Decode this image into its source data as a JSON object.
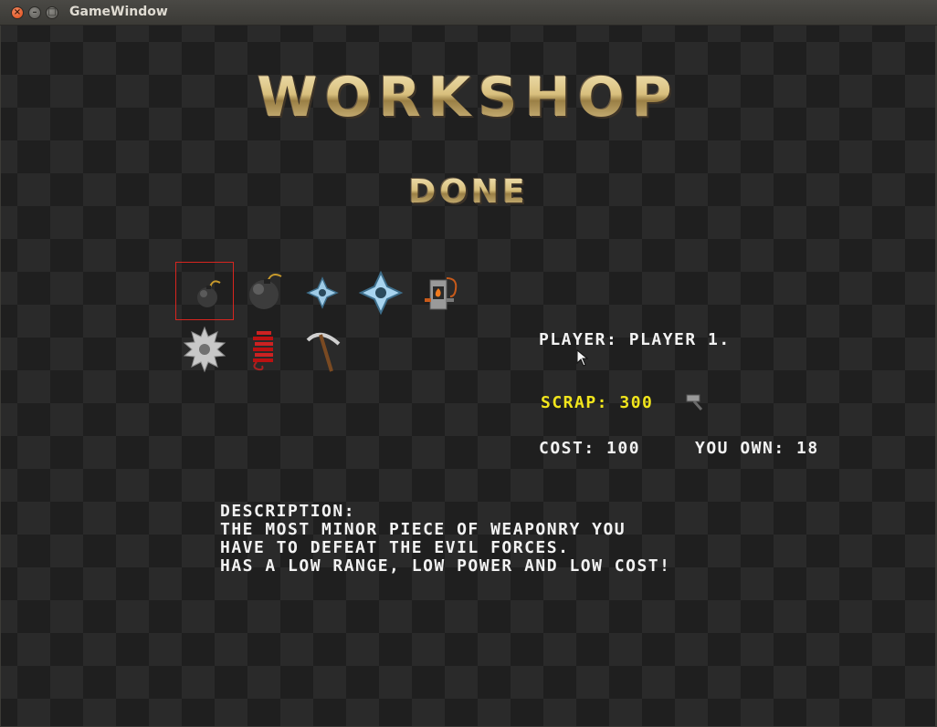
{
  "window": {
    "title": "GameWindow",
    "close_glyph": "×",
    "minimize_glyph": "–",
    "maximize_glyph": "□"
  },
  "screen": {
    "title": "WORKSHOP",
    "done_label": "DONE"
  },
  "items": [
    {
      "name": "small-bomb",
      "icon": "small-bomb-icon",
      "selected": true
    },
    {
      "name": "large-bomb",
      "icon": "large-bomb-icon",
      "selected": false
    },
    {
      "name": "small-shuriken",
      "icon": "small-shuriken-icon",
      "selected": false
    },
    {
      "name": "large-shuriken",
      "icon": "large-shuriken-icon",
      "selected": false
    },
    {
      "name": "fire-trap",
      "icon": "fire-trap-icon",
      "selected": false
    },
    {
      "name": "saw-blade",
      "icon": "saw-blade-icon",
      "selected": false
    },
    {
      "name": "dynamite-coil",
      "icon": "dynamite-coil-icon",
      "selected": false
    },
    {
      "name": "pickaxe",
      "icon": "pickaxe-icon",
      "selected": false
    }
  ],
  "info": {
    "player": "PLAYER: PLAYER 1.",
    "scrap": "SCRAP: 300",
    "cost": "COST: 100",
    "own": "YOU OWN: 18"
  },
  "description": {
    "heading": "DESCRIPTION:",
    "line1": "THE MOST MINOR PIECE OF WEAPONRY YOU",
    "line2": "HAVE TO DEFEAT THE EVIL FORCES.",
    "line3": "HAS A LOW RANGE, LOW POWER AND LOW COST!"
  },
  "colors": {
    "selection": "#d8251f",
    "scrap_text": "#f1e51c",
    "gold_title": "#d9c28a"
  }
}
